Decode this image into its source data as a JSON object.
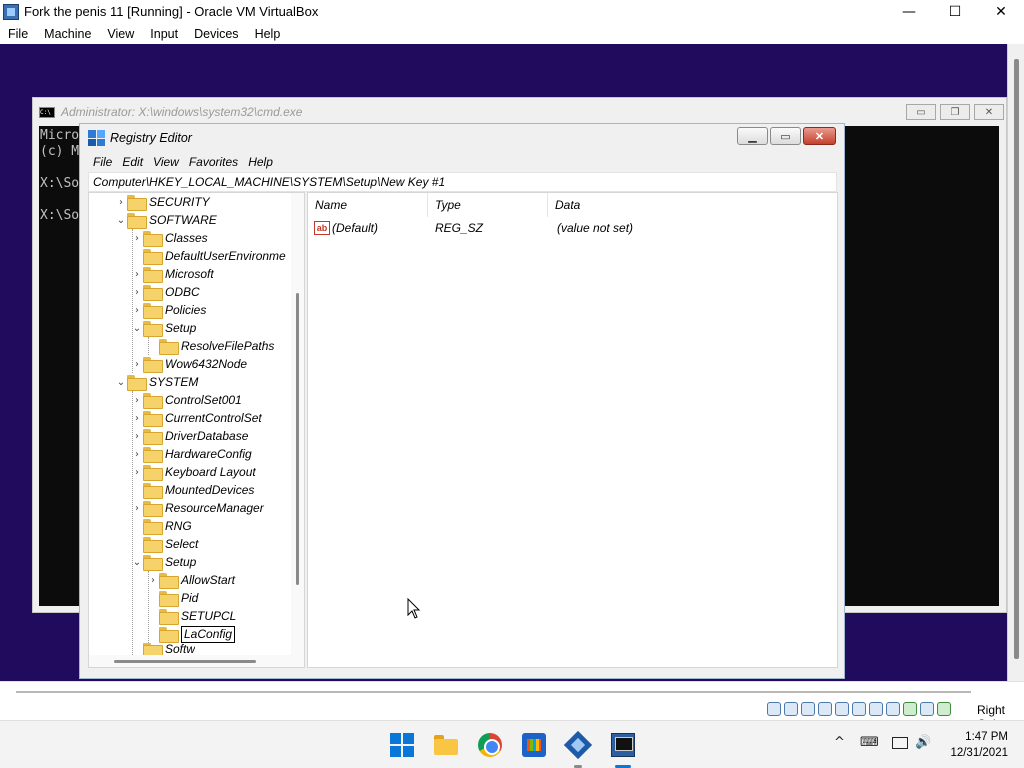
{
  "vbox": {
    "title": "Fork the penis 11 [Running] - Oracle VM VirtualBox",
    "minimize": "—",
    "maximize": "☐",
    "close": "✕",
    "menu": [
      "File",
      "Machine",
      "View",
      "Input",
      "Devices",
      "Help"
    ],
    "host_key": "Right Ctrl"
  },
  "cmd": {
    "title": "Administrator: X:\\windows\\system32\\cmd.exe",
    "lines": [
      "Micro",
      "(c) M",
      "",
      "X:\\So",
      "",
      "X:\\So"
    ],
    "minimize": "▭",
    "restore": "❐",
    "close": "✕"
  },
  "regedit": {
    "title": "Registry Editor",
    "minimize": "▁",
    "maximize": "▭",
    "close": "✕",
    "menu": [
      "File",
      "Edit",
      "View",
      "Favorites",
      "Help"
    ],
    "address": "Computer\\HKEY_LOCAL_MACHINE\\SYSTEM\\Setup\\New Key #1",
    "tree": [
      {
        "label": "SECURITY",
        "arrow": "›"
      },
      {
        "label": "SOFTWARE",
        "arrow": "⌄"
      },
      {
        "label": "Classes",
        "arrow": "›"
      },
      {
        "label": "DefaultUserEnvironme",
        "arrow": ""
      },
      {
        "label": "Microsoft",
        "arrow": "›"
      },
      {
        "label": "ODBC",
        "arrow": "›"
      },
      {
        "label": "Policies",
        "arrow": "›"
      },
      {
        "label": "Setup",
        "arrow": "⌄"
      },
      {
        "label": "ResolveFilePaths",
        "arrow": ""
      },
      {
        "label": "Wow6432Node",
        "arrow": "›"
      },
      {
        "label": "SYSTEM",
        "arrow": "⌄"
      },
      {
        "label": "ControlSet001",
        "arrow": "›"
      },
      {
        "label": "CurrentControlSet",
        "arrow": "›"
      },
      {
        "label": "DriverDatabase",
        "arrow": "›"
      },
      {
        "label": "HardwareConfig",
        "arrow": "›"
      },
      {
        "label": "Keyboard Layout",
        "arrow": "›"
      },
      {
        "label": "MountedDevices",
        "arrow": ""
      },
      {
        "label": "ResourceManager",
        "arrow": "›"
      },
      {
        "label": "RNG",
        "arrow": ""
      },
      {
        "label": "Select",
        "arrow": ""
      },
      {
        "label": "Setup",
        "arrow": "⌄"
      },
      {
        "label": "AllowStart",
        "arrow": "›"
      },
      {
        "label": "Pid",
        "arrow": ""
      },
      {
        "label": "SETUPCL",
        "arrow": ""
      },
      {
        "label": "LaConfig",
        "arrow": ""
      },
      {
        "label": "Softw",
        "arrow": ""
      }
    ],
    "columns": [
      "Name",
      "Type",
      "Data"
    ],
    "values": [
      {
        "icon": "ab",
        "name": "(Default)",
        "type": "REG_SZ",
        "data": "(value not set)"
      }
    ]
  },
  "taskbar": {
    "time": "1:47 PM",
    "date": "12/31/2021",
    "tray_chevron": "^",
    "keyboard": "⌨",
    "volume": "🔊"
  },
  "colors": {
    "guest_bg": "#200b5c",
    "accent": "#0a76d8"
  }
}
